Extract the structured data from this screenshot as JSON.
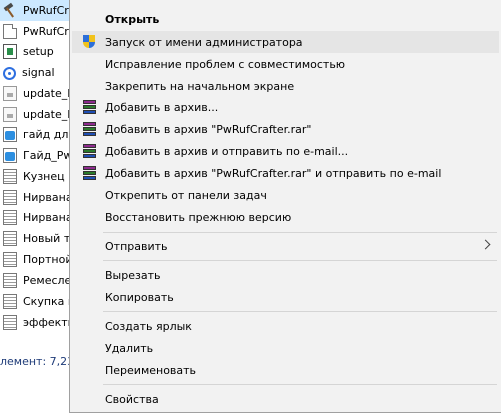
{
  "files": [
    {
      "label": "PwRufCr",
      "icon": "hammer-icon",
      "selected": true
    },
    {
      "label": "PwRufCr",
      "icon": "document-icon"
    },
    {
      "label": "setup",
      "icon": "setup-icon"
    },
    {
      "label": "signal",
      "icon": "signal-icon"
    },
    {
      "label": "update_F",
      "icon": "update-icon"
    },
    {
      "label": "update_F",
      "icon": "update-icon"
    },
    {
      "label": "гайд для",
      "icon": "telegram-doc-icon"
    },
    {
      "label": "Гайд_Pw",
      "icon": "telegram-doc-icon"
    },
    {
      "label": "Кузнец",
      "icon": "text-document-icon"
    },
    {
      "label": "Нирвана",
      "icon": "text-document-icon"
    },
    {
      "label": "Нирвана",
      "icon": "text-document-icon"
    },
    {
      "label": "Новый т",
      "icon": "text-document-icon"
    },
    {
      "label": "Портной",
      "icon": "text-document-icon"
    },
    {
      "label": "Ремесле",
      "icon": "text-document-icon"
    },
    {
      "label": "Скупка м",
      "icon": "text-document-icon"
    },
    {
      "label": "эффекть",
      "icon": "text-document-icon"
    }
  ],
  "status": {
    "text": "лемент: 7,23"
  },
  "menu": {
    "open": "Открыть",
    "run_as_admin": "Запуск от имени администратора",
    "troubleshoot_compat": "Исправление проблем с совместимостью",
    "pin_to_start": "Закрепить на начальном экране",
    "add_to_archive": "Добавить в архив...",
    "add_to_named_archive": "Добавить в архив \"PwRufCrafter.rar\"",
    "add_and_email": "Добавить в архив и отправить по e-mail...",
    "add_named_and_email": "Добавить в архив \"PwRufCrafter.rar\" и отправить по e-mail",
    "unpin_taskbar": "Открепить от панели задач",
    "restore_previous": "Восстановить прежнюю версию",
    "send_to": "Отправить",
    "cut": "Вырезать",
    "copy": "Копировать",
    "create_shortcut": "Создать ярлык",
    "delete": "Удалить",
    "rename": "Переименовать",
    "properties": "Свойства"
  },
  "colors": {
    "menu_bg": "#f2f2f2",
    "menu_hover": "#e5e5e5",
    "selection": "#cce8ff",
    "shield_blue": "#2c6fd9",
    "shield_yellow": "#f1c21b"
  }
}
